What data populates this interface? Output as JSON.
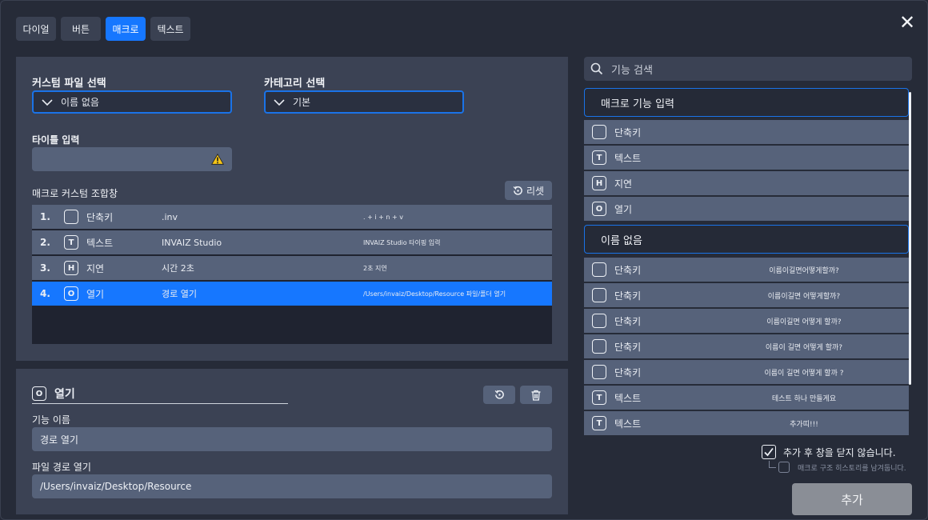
{
  "tabs": [
    "다이얼",
    "버튼",
    "매크로",
    "텍스트"
  ],
  "close_glyph": "✕",
  "editor": {
    "custom_file_label": "커스텀 파일 선택",
    "custom_file_value": "이름 없음",
    "category_label": "카테고리 선택",
    "category_value": "기본",
    "title_label": "타이틀 입력",
    "title_value": "",
    "combo_label": "매크로 커스텀 조합창",
    "reset_label": "리셋",
    "rows": [
      {
        "num": "1.",
        "badge": "",
        "name": "단축키",
        "value": ".inv",
        "desc": ". + i + n + v"
      },
      {
        "num": "2.",
        "badge": "T",
        "name": "텍스트",
        "value": "INVAIZ Studio",
        "desc": "INVAIZ Studio 타이핑 입력"
      },
      {
        "num": "3.",
        "badge": "H",
        "name": "지연",
        "value": "시간 2초",
        "desc": "2초 지연"
      },
      {
        "num": "4.",
        "badge": "O",
        "name": "열기",
        "value": "경로 열기",
        "desc": "/Users/invaiz/Desktop/Resource 파일/폴더 열기"
      }
    ]
  },
  "detail": {
    "badge": "O",
    "title": "열기",
    "func_name_label": "기능 이름",
    "func_name_value": "경로 열기",
    "path_label": "파일 경로 열기",
    "path_value": "/Users/invaiz/Desktop/Resource"
  },
  "sidebar": {
    "search_placeholder": "기능 검색",
    "group1": "매크로 기능 입력",
    "group1_items": [
      {
        "badge": "",
        "name": "단축키"
      },
      {
        "badge": "T",
        "name": "텍스트"
      },
      {
        "badge": "H",
        "name": "지연"
      },
      {
        "badge": "O",
        "name": "열기"
      }
    ],
    "group2": "이름 없음",
    "group2_items": [
      {
        "badge": "",
        "name": "단축키",
        "desc": "이름이길면어떻게할까?"
      },
      {
        "badge": "",
        "name": "단축키",
        "desc": "이름이길면 어떻게할까?"
      },
      {
        "badge": "",
        "name": "단축키",
        "desc": "이름이길면 어떻게 할까?"
      },
      {
        "badge": "",
        "name": "단축키",
        "desc": "이름이 길면 어떻게 할까?"
      },
      {
        "badge": "",
        "name": "단축키",
        "desc": "이름이 길면 어떻게 할까 ?"
      },
      {
        "badge": "T",
        "name": "텍스트",
        "desc": "테스트 하나 만들게요"
      },
      {
        "badge": "T",
        "name": "텍스트",
        "desc": "추가띠!!!"
      }
    ],
    "keep_open_label": "추가 후 창을 닫지 않습니다.",
    "keep_open_checked": true,
    "history_label": "매크로 구조 히스토리를 남겨둡니다.",
    "history_checked": false,
    "add_label": "추가"
  }
}
